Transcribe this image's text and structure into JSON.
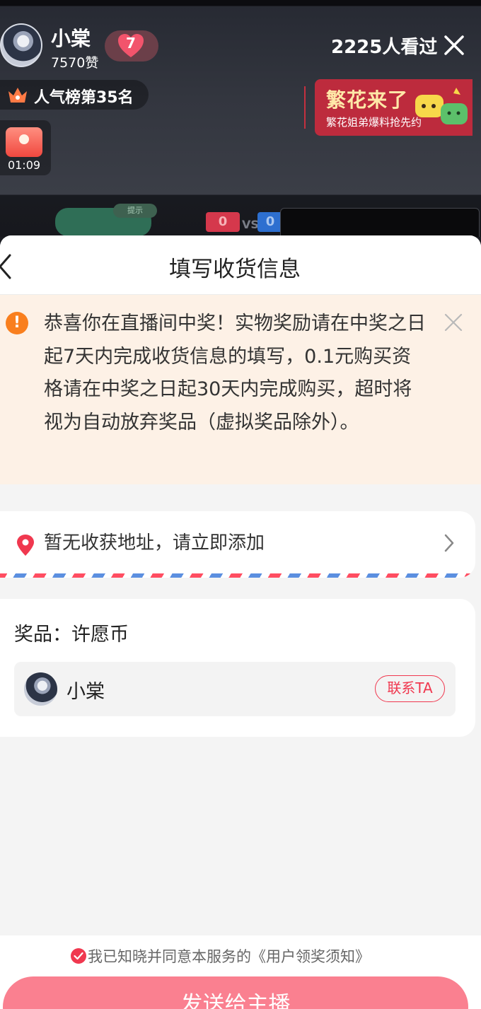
{
  "live": {
    "host_name": "小棠",
    "likes": "7570赞",
    "fan_level": "7",
    "viewers": "2225人看过",
    "rank": "人气榜第35名",
    "gift_timer": "01:09",
    "banner": {
      "title": "繁花来了",
      "subtitle": "繁花姐弟爆料抢先约"
    },
    "pk": {
      "hint": "提示",
      "score_left": "0",
      "vs": "VS",
      "score_right": "0"
    }
  },
  "sheet": {
    "title": "填写收货信息",
    "notice": "恭喜你在直播间中奖！实物奖励请在中奖之日起7天内完成收货信息的填写，0.1元购买资格请在中奖之日起30天内完成购买，超时将视为自动放弃奖品（虚拟奖品除外）。",
    "notice_icon": "!",
    "address_placeholder": "暂无收获地址，请立即添加",
    "prize_label": "奖品：许愿币",
    "host_name": "小棠",
    "contact_label": "联系TA",
    "agreement": "我已知晓并同意本服务的《用户领奖须知》",
    "send_label": "发送给主播"
  },
  "colors": {
    "accent": "#f0384f",
    "send_button": "#fa8090",
    "notice_bg": "#fdf1e6",
    "notice_icon": "#f97f1e",
    "banner_bg": "#bd2b3d"
  }
}
